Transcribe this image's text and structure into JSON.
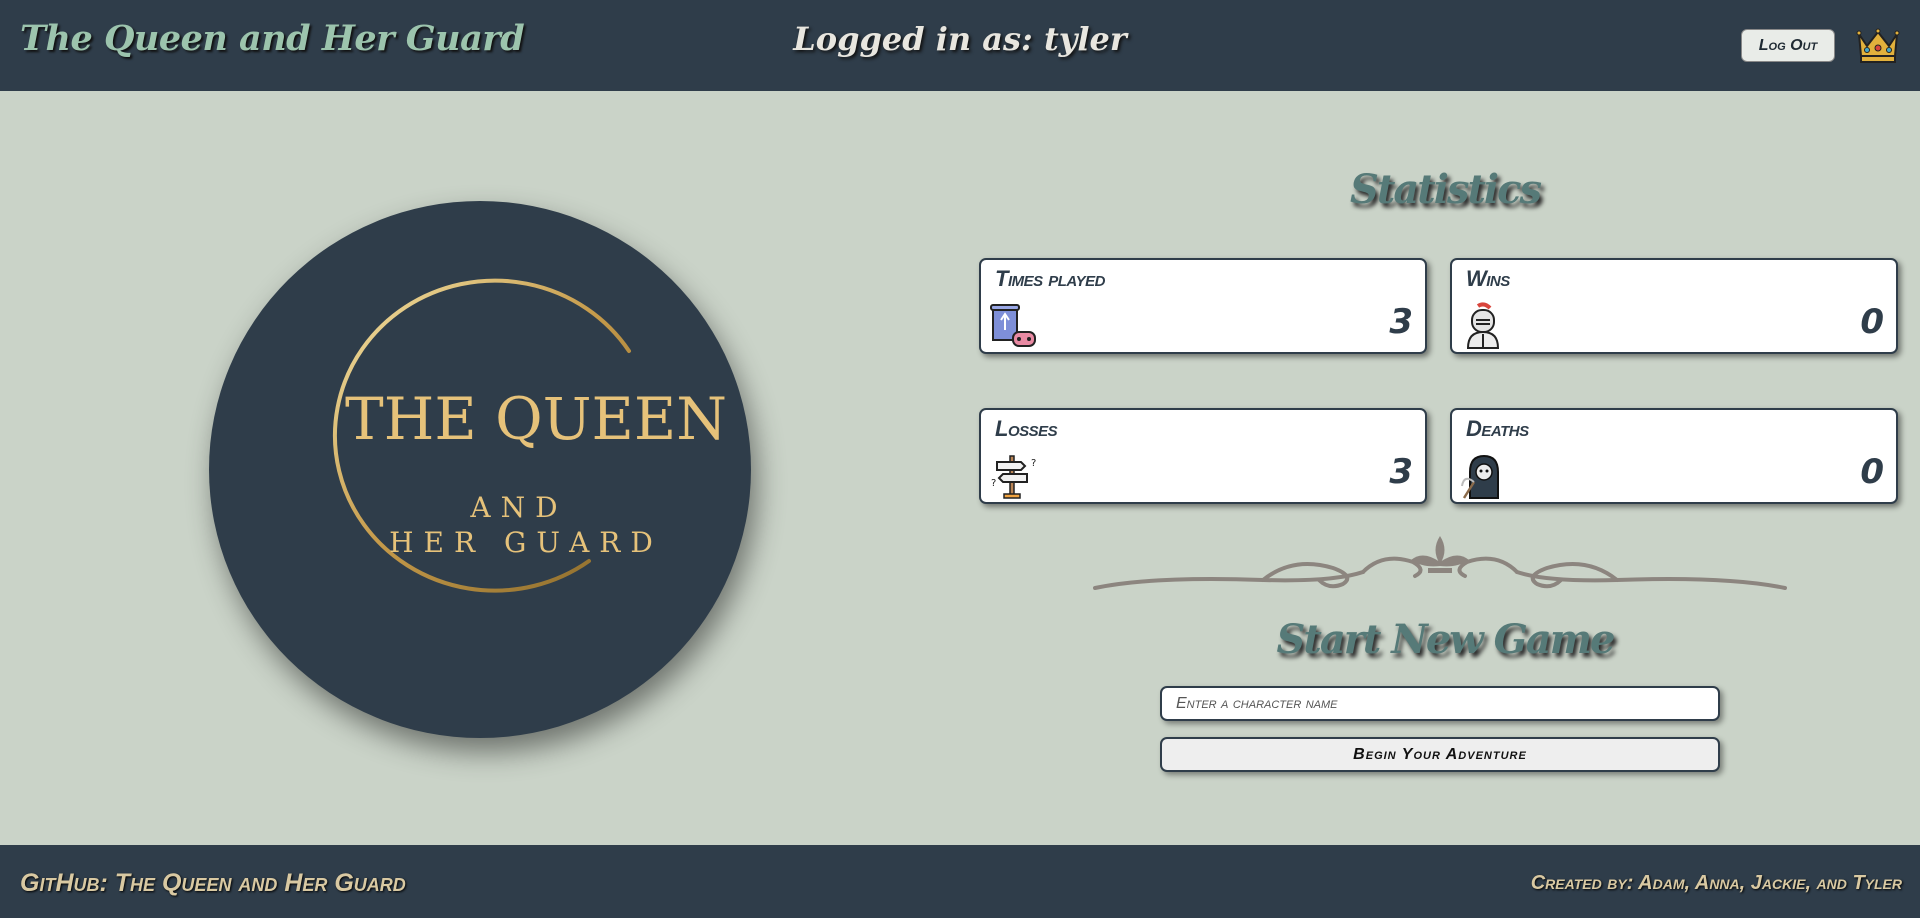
{
  "header": {
    "site_title": "The Queen and Her Guard",
    "logged_in_text": "Logged in as: tyler",
    "logout_label": "Log Out",
    "crown_icon": "crown-icon"
  },
  "logo": {
    "line1": "THE QUEEN",
    "line2": "AND",
    "line3": "HER GUARD"
  },
  "statistics": {
    "title": "Statistics",
    "cards": [
      {
        "label": "Times played",
        "value": "3",
        "icon": "scroll-gamepad-icon"
      },
      {
        "label": "Wins",
        "value": "0",
        "icon": "knight-icon"
      },
      {
        "label": "Losses",
        "value": "3",
        "icon": "signpost-icon"
      },
      {
        "label": "Deaths",
        "value": "0",
        "icon": "grim-reaper-icon"
      }
    ]
  },
  "new_game": {
    "title": "Start New Game",
    "input_placeholder": "Enter a character name",
    "input_value": "",
    "begin_label": "Begin Your Adventure"
  },
  "footer": {
    "github_text": "GitHub: The Queen and Her Guard",
    "credits_text": "Created by: Adam, Anna, Jackie, and Tyler"
  },
  "colors": {
    "header_bg": "#2f3d4a",
    "page_bg": "#cad3c8",
    "accent_teal": "#567a78",
    "gold": "#d4b06a"
  }
}
